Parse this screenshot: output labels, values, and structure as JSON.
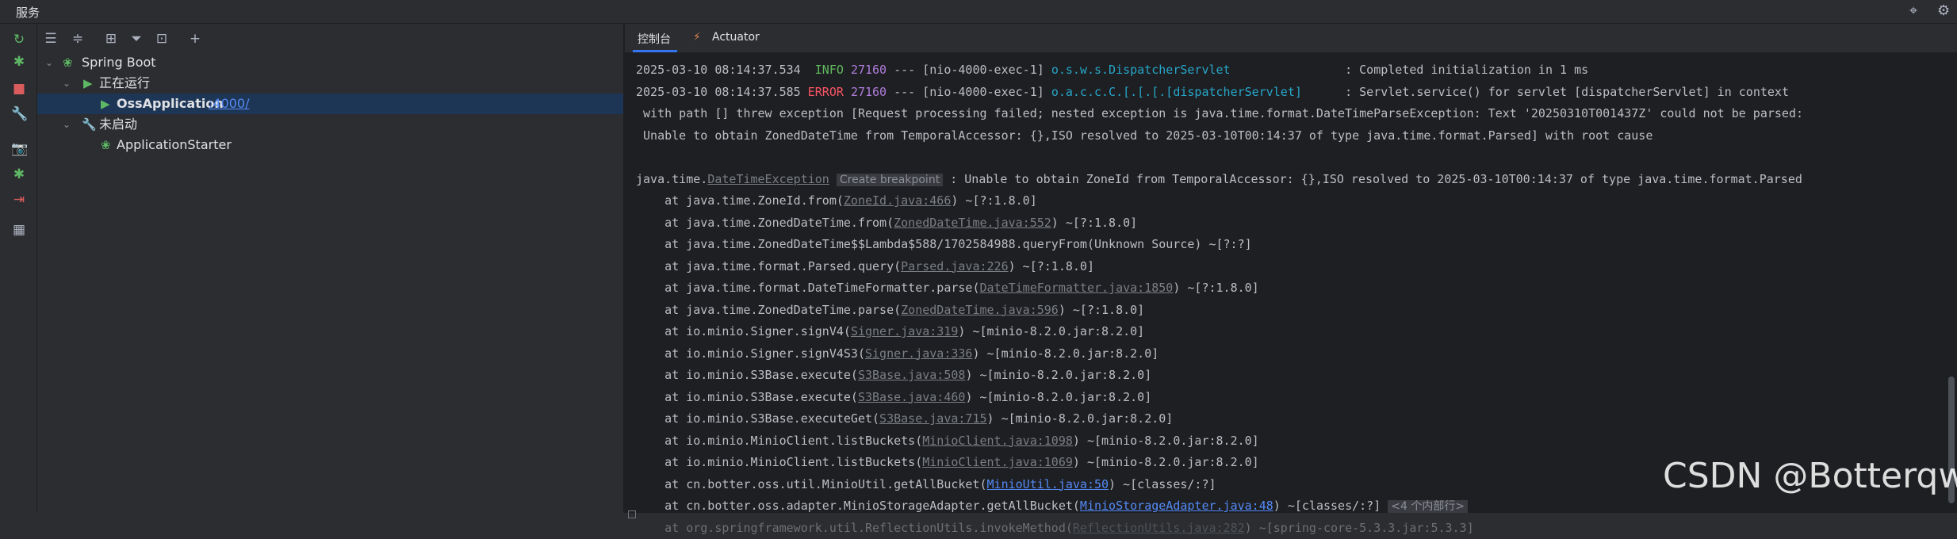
{
  "window": {
    "title": "服务"
  },
  "title_icons": [
    "target-icon",
    "gear-icon"
  ],
  "left_toolbar": [
    {
      "name": "rerun-icon",
      "glyph": "↻",
      "color": "#5fb865"
    },
    {
      "name": "debug-icon",
      "glyph": "✱",
      "color": "#5fb865"
    },
    {
      "name": "stop-icon",
      "glyph": "■",
      "color": "#db5c5c"
    },
    {
      "name": "wrench-icon",
      "glyph": "🔧",
      "color": "#aeb3c2"
    },
    {
      "name": "camera-icon",
      "glyph": "📷",
      "color": "#aeb3c2"
    },
    {
      "name": "bug-settings-icon",
      "glyph": "✱",
      "color": "#5fb865"
    },
    {
      "name": "exit-icon",
      "glyph": "⇥",
      "color": "#db5c5c"
    },
    {
      "name": "layout-icon",
      "glyph": "▦",
      "color": "#aeb3c2"
    }
  ],
  "tree_toolbar": [
    {
      "name": "expand-all-icon",
      "glyph": "☰"
    },
    {
      "name": "collapse-all-icon",
      "glyph": "≑"
    },
    {
      "name": "group-icon",
      "glyph": "⊞"
    },
    {
      "name": "filter-icon",
      "glyph": "⏷"
    },
    {
      "name": "new-tab-icon",
      "glyph": "⊡"
    },
    {
      "name": "add-icon",
      "glyph": "+"
    }
  ],
  "tree": {
    "root": "Spring Boot",
    "running_group": "正在运行",
    "running_app": "OssApplication",
    "running_port": ":4000/",
    "stopped_group": "未启动",
    "stopped_app": "ApplicationStarter"
  },
  "tabs": {
    "console": "控制台",
    "actuator": "Actuator"
  },
  "console": {
    "l1": {
      "ts": "2025-03-10 08:14:37.534",
      "level": "INFO",
      "pid": "27160",
      "sep": "---",
      "thread": "[nio-4000-exec-1]",
      "logger": "o.s.w.s.DispatcherServlet",
      "msg": ": Completed initialization in 1 ms"
    },
    "l2": {
      "ts": "2025-03-10 08:14:37.585",
      "level": "ERROR",
      "pid": "27160",
      "sep": "---",
      "thread": "[nio-4000-exec-1]",
      "logger": "o.a.c.c.C.[.[.[.[dispatcherServlet]",
      "msg": ": Servlet.service() for servlet [dispatcherServlet] in context"
    },
    "l3": " with path [] threw exception [Request processing failed; nested exception is java.time.format.DateTimeParseException: Text '20250310T001437Z' could not be parsed:",
    "l4": " Unable to obtain ZonedDateTime from TemporalAccessor: {},ISO resolved to 2025-03-10T00:14:37 of type java.time.format.Parsed] with root cause",
    "l5": {
      "pre": "java.time.",
      "link": "DateTimeException",
      "hint": "Create breakpoint",
      "post": ": Unable to obtain ZoneId from TemporalAccessor: {},ISO resolved to 2025-03-10T00:14:37 of type java.time.format.Parsed"
    },
    "frames": [
      {
        "pre": "    at java.time.ZoneId.from(",
        "link": "ZoneId.java:466",
        "post": ") ~[?:1.8.0]"
      },
      {
        "pre": "    at java.time.ZonedDateTime.from(",
        "link": "ZonedDateTime.java:552",
        "post": ") ~[?:1.8.0]"
      },
      {
        "pre": "    at java.time.ZonedDateTime$$Lambda$588/1702584988.queryFrom(Unknown Source) ~[?:?]",
        "link": "",
        "post": ""
      },
      {
        "pre": "    at java.time.format.Parsed.query(",
        "link": "Parsed.java:226",
        "post": ") ~[?:1.8.0]"
      },
      {
        "pre": "    at java.time.format.DateTimeFormatter.parse(",
        "link": "DateTimeFormatter.java:1850",
        "post": ") ~[?:1.8.0]"
      },
      {
        "pre": "    at java.time.ZonedDateTime.parse(",
        "link": "ZonedDateTime.java:596",
        "post": ") ~[?:1.8.0]"
      },
      {
        "pre": "    at io.minio.Signer.signV4(",
        "link": "Signer.java:319",
        "post": ") ~[minio-8.2.0.jar:8.2.0]"
      },
      {
        "pre": "    at io.minio.Signer.signV4S3(",
        "link": "Signer.java:336",
        "post": ") ~[minio-8.2.0.jar:8.2.0]"
      },
      {
        "pre": "    at io.minio.S3Base.execute(",
        "link": "S3Base.java:508",
        "post": ") ~[minio-8.2.0.jar:8.2.0]"
      },
      {
        "pre": "    at io.minio.S3Base.execute(",
        "link": "S3Base.java:460",
        "post": ") ~[minio-8.2.0.jar:8.2.0]"
      },
      {
        "pre": "    at io.minio.S3Base.executeGet(",
        "link": "S3Base.java:715",
        "post": ") ~[minio-8.2.0.jar:8.2.0]"
      },
      {
        "pre": "    at io.minio.MinioClient.listBuckets(",
        "link": "MinioClient.java:1098",
        "post": ") ~[minio-8.2.0.jar:8.2.0]"
      },
      {
        "pre": "    at io.minio.MinioClient.listBuckets(",
        "link": "MinioClient.java:1069",
        "post": ") ~[minio-8.2.0.jar:8.2.0]"
      }
    ],
    "l19": {
      "pre": "    at cn.botter.oss.util.MinioUtil.getAllBucket(",
      "link": "MinioUtil.java:50",
      "post": ") ~[classes/:?]"
    },
    "l20": {
      "pre": "    at cn.botter.oss.adapter.MinioStorageAdapter.getAllBucket(",
      "link": "MinioStorageAdapter.java:48",
      "post": ") ~[classes/:?]",
      "fold": "<4 个内部行>"
    },
    "l21": {
      "pre": "    at org.springframework.util.ReflectionUtils.invokeMethod(",
      "link": "ReflectionUtils.java:282",
      "post": ") ~[spring-core-5.3.3.jar:5.3.3]"
    }
  },
  "watermark": "CSDN @Botterqw",
  "colors": {
    "background": "#1e1f22",
    "panel": "#2b2d30",
    "accent": "#3574f0",
    "error": "#f75464",
    "info": "#5fb95f"
  }
}
